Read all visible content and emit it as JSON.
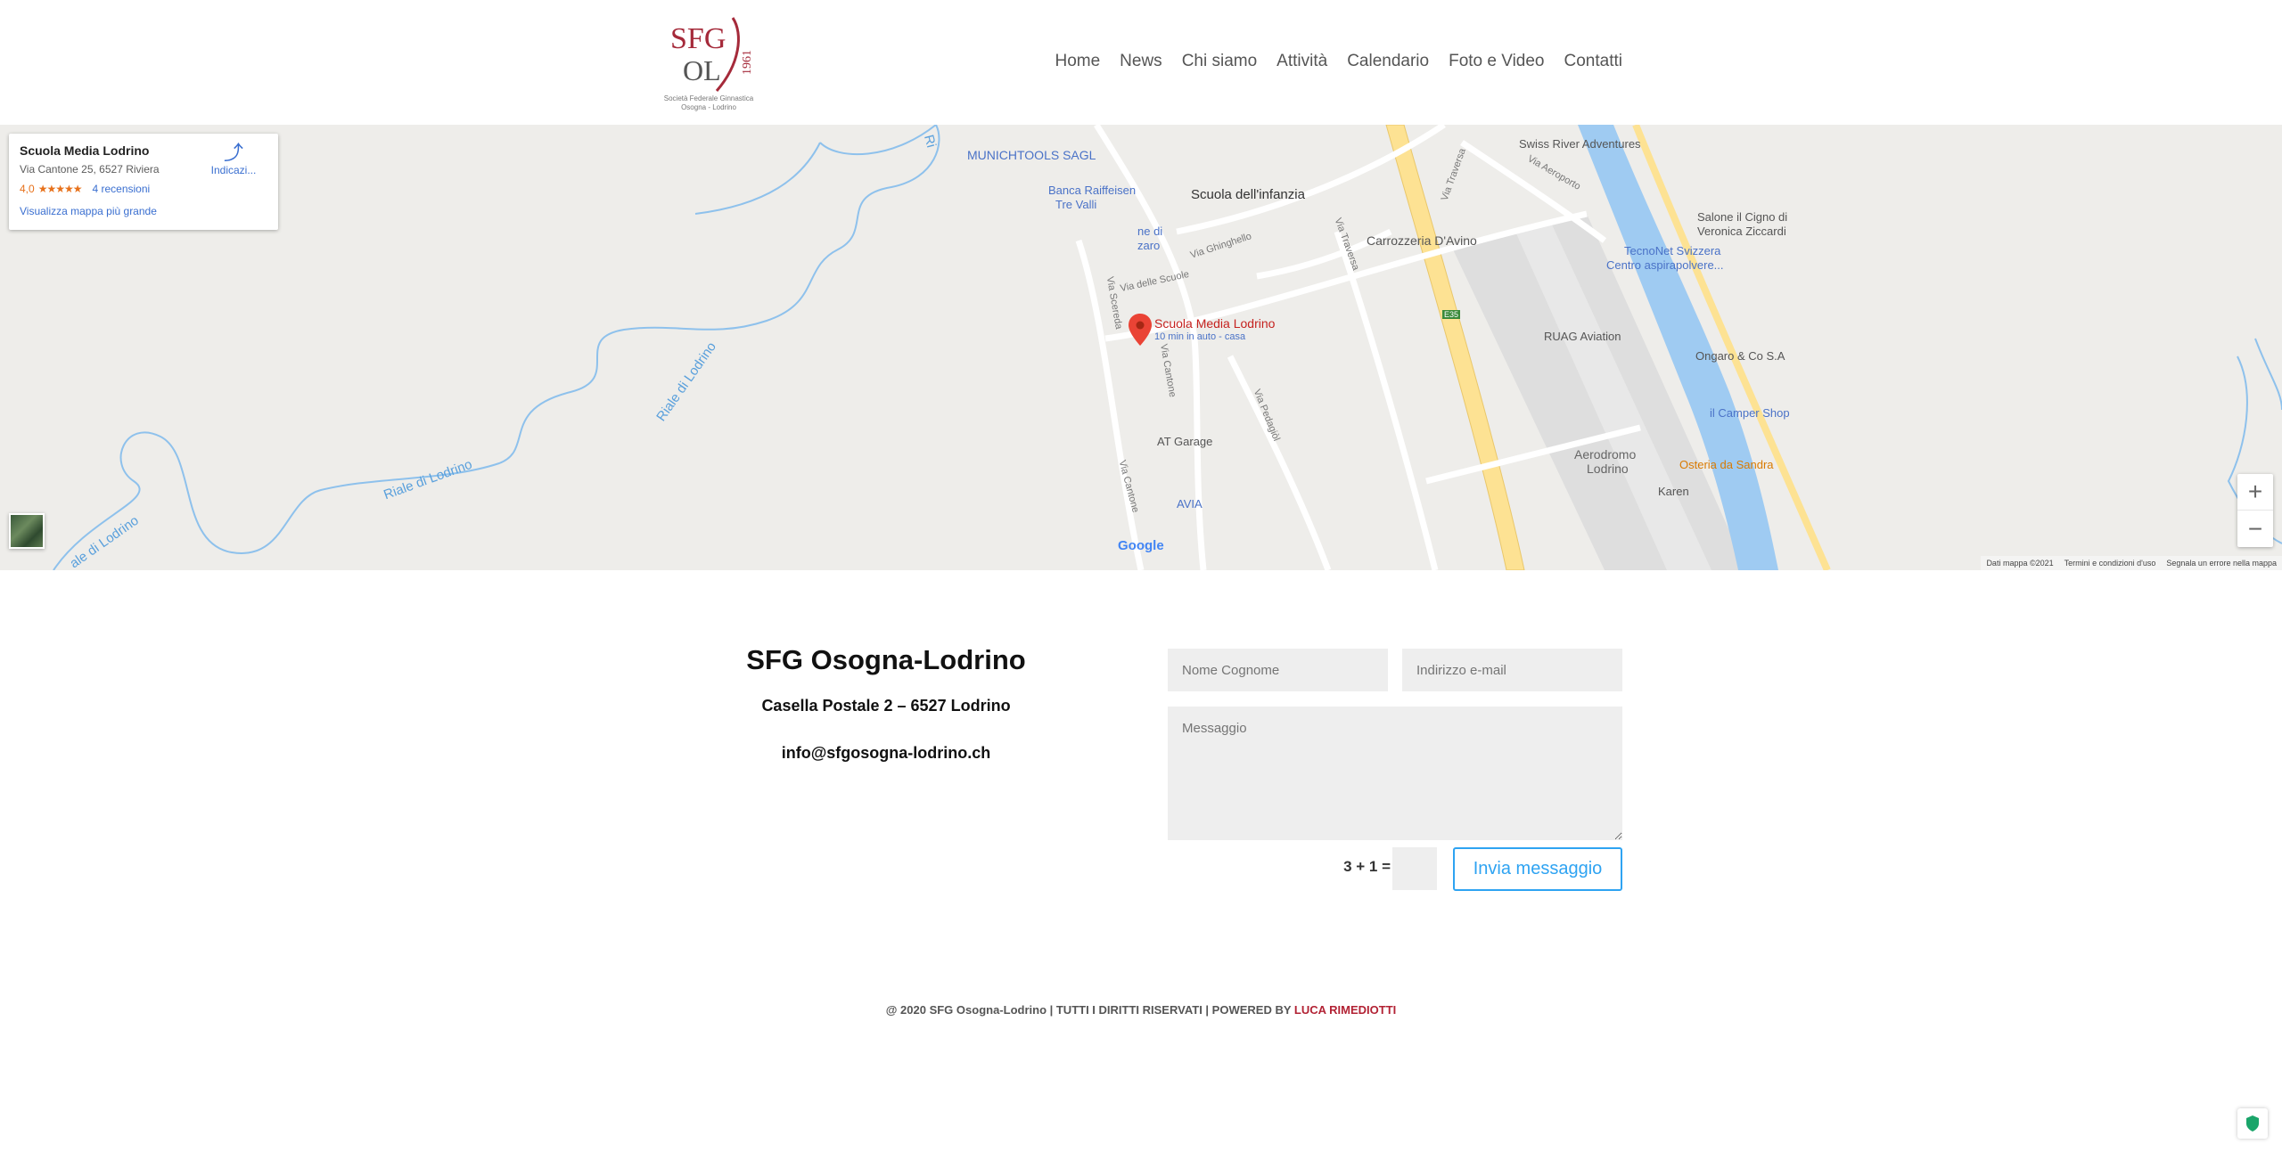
{
  "header": {
    "logo_text_top": "SFG",
    "logo_text_mid": "OL",
    "logo_year": "1961",
    "logo_sub1": "Società Federale Ginnastica",
    "logo_sub2": "Osogna - Lodrino",
    "nav": [
      "Home",
      "News",
      "Chi siamo",
      "Attività",
      "Calendario",
      "Foto e Video",
      "Contatti"
    ]
  },
  "map": {
    "card_title": "Scuola Media Lodrino",
    "card_address": "Via Cantone 25, 6527 Riviera",
    "card_rating": "4,0",
    "card_stars": "★★★★★",
    "card_reviews": "4 recensioni",
    "card_bigger": "Visualizza mappa più grande",
    "card_directions": "Indicazi...",
    "marker_title": "Scuola Media Lodrino",
    "marker_sub": "10 min in auto - casa",
    "places": {
      "munichtools": "MUNICHTOOLS SAGL",
      "banca1": "Banca Raiffeisen",
      "banca2": "Tre Valli",
      "zarro1": "ne di",
      "zarro2": "zaro",
      "scuola_infanzia": "Scuola dell'infanzia",
      "carrozzeria": "Carrozzeria D'Avino",
      "swiss_river": "Swiss River Adventures",
      "salone1": "Salone il Cigno di",
      "salone2": "Veronica Ziccardi",
      "tecnonet1": "TecnoNet Svizzera",
      "tecnonet2": "Centro aspirapolvere...",
      "ruag": "RUAG Aviation",
      "ongaro": "Ongaro & Co S.A",
      "camper": "il Camper Shop",
      "osteria": "Osteria da Sandra",
      "aerodromo1": "Aerodromo",
      "aerodromo2": "Lodrino",
      "karen": "Karen",
      "at_garage": "AT Garage",
      "avia": "AVIA"
    },
    "roads": {
      "via_traversa": "Via Traversa",
      "via_aeroporto": "Via Aeroporto",
      "via_ghinghello": "Via Ghinghello",
      "via_delle_scuole": "Via delle Scuole",
      "via_scereda": "Via Scereda",
      "via_traversa2": "Via Traversa",
      "via_cantone": "Via Cantone",
      "via_pedagiol": "Via Pedagiòl",
      "via_cantone2": "Via Cantone",
      "e35": "E35"
    },
    "rivers": {
      "riale1": "Riale di Lodrino",
      "riale2": "Riale di Lodrino",
      "riale3": "ale di Lodrino",
      "ri": "Ri"
    },
    "zoom_in": "+",
    "zoom_out": "−",
    "footer_data": "Dati mappa ©2021",
    "footer_terms": "Termini e condizioni d'uso",
    "footer_report": "Segnala un errore nella mappa",
    "google": "Google"
  },
  "contact": {
    "title": "SFG Osogna-Lodrino",
    "address": "Casella Postale 2 – 6527 Lodrino",
    "email": "info@sfgosogna-lodrino.ch",
    "name_placeholder": "Nome Cognome",
    "email_placeholder": "Indirizzo e-mail",
    "message_placeholder": "Messaggio",
    "captcha": "3 + 1 =",
    "submit": "Invia messaggio"
  },
  "footer": {
    "text": "@ 2020 SFG Osogna-Lodrino | TUTTI I DIRITTI RISERVATI | POWERED BY",
    "link": "LUCA RIMEDIOTTI"
  },
  "colors": {
    "accent": "#2ea3f2",
    "brand_red": "#b22234"
  }
}
